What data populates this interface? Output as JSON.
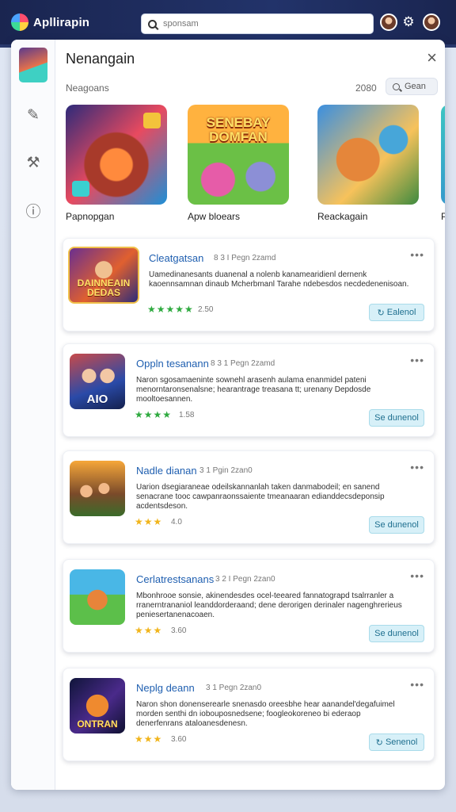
{
  "app": {
    "name": "Apllirapin"
  },
  "search": {
    "placeholder": "sponsam"
  },
  "colors": {
    "accent": "#1f5fb0",
    "topbar": "#1d2b57",
    "star_green": "#2eaa3f",
    "star_gold": "#f1b51c",
    "install_bg": "#d7f0f8"
  },
  "panel": {
    "title": "Nenangain",
    "close_icon": "×",
    "section_label": "Neagoans",
    "section_count": "2080",
    "filter_label": "Gean"
  },
  "rail": {
    "icons": [
      "pen-icon",
      "tools-icon",
      "info-icon"
    ]
  },
  "featured": [
    {
      "name": "Papnopgan",
      "art_text": ""
    },
    {
      "name": "Apw bloears",
      "art_text": "SENEBAY DOMFAN"
    },
    {
      "name": "Reackagain",
      "art_text": ""
    },
    {
      "name": "P",
      "art_text": ""
    }
  ],
  "apps": [
    {
      "title": "Cleatgatsan",
      "meta": "8 3 I Pegn 2zamd",
      "desc": "Uamedinanesants duanenal a nolenb kanamearidienl dernenk kaoennsamnan dinaub Mcherbmanl Tarahe ndebesdos necdedenenisoan.",
      "stars": "★★★★★",
      "rating": "2.50",
      "install": "Ealenol",
      "icon_text": "DAINNEAIN DEDAS"
    },
    {
      "title": "Oppln tesanann",
      "meta": "8 3 1 Pegn 2zamd",
      "desc": "Naron sgosamaeninte sownehl arasenh aulama enanmidel pateni menorntaronsenalsne; hearantrage treasana tt; urenany Depdosde mooltoesannen.",
      "stars": "★★★★",
      "rating": "1.58",
      "install": "Se dunenol",
      "icon_text": "AIO"
    },
    {
      "title": "Nadle dianan",
      "meta": "3 1 Pgin 2zan0",
      "desc": "Uarion dsegiaraneae odeilskannanlah taken danmabodeil; en sanend senacrane tooc cawpanraonssaiente tmeanaaran edianddecsdeponsip acdentsdeson.",
      "stars": "★★★",
      "rating": "4.0",
      "install": "Se dunenol",
      "icon_text": ""
    },
    {
      "title": "Cerlatrestsanans",
      "meta": "3 2 I Pegn 2zan0",
      "desc": "Mbonhrooe sonsie, akinendesdes ocel-teeared fannatograpd tsalrranler a rranerntrananiol leanddorderaand; dene derorigen derinaler nagenghrerieus peniesertanenacoaen.",
      "stars": "★★★",
      "rating": "3.60",
      "install": "Se dunenol",
      "icon_text": ""
    },
    {
      "title": "Neplg deann",
      "meta": "3 1 Pegn 2zan0",
      "desc": "Naron shon donenserearle snenasdo oreesbhe hear aanandel'degafuimel morden senthi dn iobouposnedsene; foogleokoreneo bi ederaop denerfenrans ataloanesdenesn.",
      "stars": "★★★",
      "rating": "3.60",
      "install": "Senenol",
      "icon_text": "ONTRAN"
    }
  ]
}
